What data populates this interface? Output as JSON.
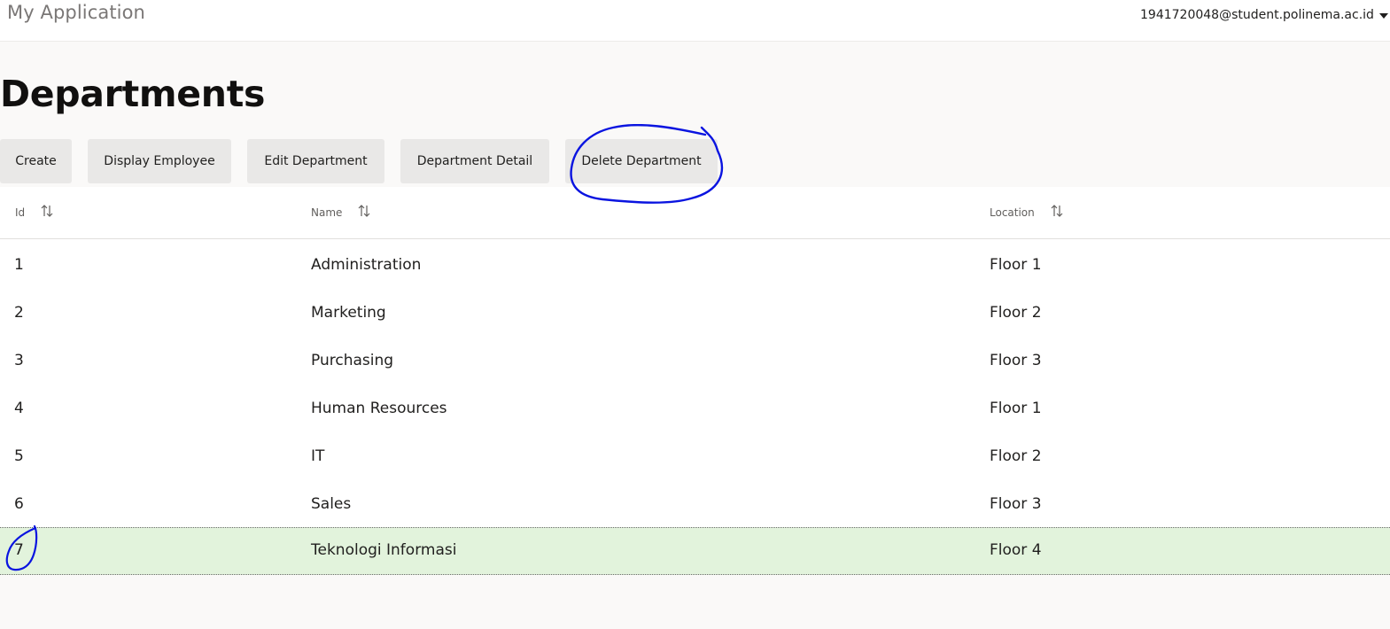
{
  "header": {
    "app_title": "My Application",
    "user_email": "1941720048@student.polinema.ac.id",
    "user_menu_icon": "caret-down-icon"
  },
  "page": {
    "title": "Departments"
  },
  "toolbar": {
    "buttons": [
      {
        "label": "Create"
      },
      {
        "label": "Display Employee"
      },
      {
        "label": "Edit Department"
      },
      {
        "label": "Department Detail"
      },
      {
        "label": "Delete Department"
      }
    ]
  },
  "table": {
    "columns": [
      {
        "label": "Id",
        "sort_icon": "sort-arrows-icon"
      },
      {
        "label": "Name",
        "sort_icon": "sort-arrows-icon"
      },
      {
        "label": "Location",
        "sort_icon": "sort-arrows-icon"
      }
    ],
    "rows": [
      {
        "id": "1",
        "name": "Administration",
        "location": "Floor 1"
      },
      {
        "id": "2",
        "name": "Marketing",
        "location": "Floor 2"
      },
      {
        "id": "3",
        "name": "Purchasing",
        "location": "Floor 3"
      },
      {
        "id": "4",
        "name": "Human Resources",
        "location": "Floor 1"
      },
      {
        "id": "5",
        "name": "IT",
        "location": "Floor 2"
      },
      {
        "id": "6",
        "name": "Sales",
        "location": "Floor 3"
      },
      {
        "id": "7",
        "name": "Teknologi Informasi",
        "location": "Floor 4"
      }
    ],
    "selected_row": "7",
    "selected_color": "#e2f3dc"
  },
  "annotations": {
    "color": "#0a14e0"
  }
}
